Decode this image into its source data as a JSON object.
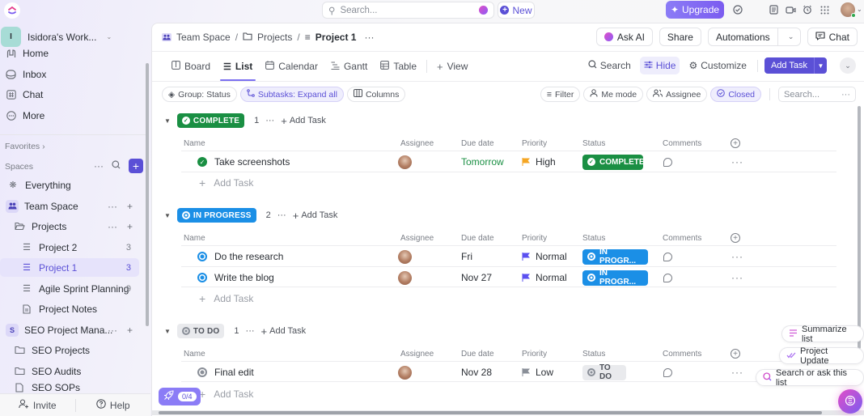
{
  "topbar": {
    "search_placeholder": "Search...",
    "new_label": "New",
    "upgrade_label": "Upgrade"
  },
  "sidebar": {
    "workspace_initial": "I",
    "workspace_name": "Isidora's Work...",
    "nav": [
      {
        "label": "Home",
        "icon": "home-icon"
      },
      {
        "label": "Inbox",
        "icon": "inbox-icon"
      },
      {
        "label": "Chat",
        "icon": "chat-icon"
      },
      {
        "label": "More",
        "icon": "more-icon"
      }
    ],
    "favorites_label": "Favorites",
    "spaces_label": "Spaces",
    "tree": [
      {
        "label": "Everything",
        "icon": "everything-icon"
      },
      {
        "label": "Team Space",
        "icon": "team-space-icon"
      },
      {
        "label": "Projects",
        "icon": "folder-open-icon"
      },
      {
        "label": "Project 2",
        "icon": "list-icon",
        "count": "3"
      },
      {
        "label": "Project 1",
        "icon": "list-icon",
        "count": "3",
        "active": true
      },
      {
        "label": "Agile Sprint Planning",
        "icon": "list-icon",
        "count": "9"
      },
      {
        "label": "Project Notes",
        "icon": "doc-icon"
      },
      {
        "label": "SEO Project Mana...",
        "icon": "space-s-icon",
        "initial": "S"
      },
      {
        "label": "SEO Projects",
        "icon": "folder-icon"
      },
      {
        "label": "SEO Audits",
        "icon": "folder-icon"
      },
      {
        "label": "SEO SOPs",
        "icon": "doc-icon"
      }
    ],
    "invite_label": "Invite",
    "help_label": "Help"
  },
  "header": {
    "breadcrumb": [
      "Team Space",
      "Projects",
      "Project 1"
    ],
    "ask_ai_label": "Ask AI",
    "share_label": "Share",
    "automations_label": "Automations",
    "chat_label": "Chat"
  },
  "views": {
    "tabs": [
      {
        "label": "Board",
        "icon": "board-icon"
      },
      {
        "label": "List",
        "icon": "list-icon",
        "active": true
      },
      {
        "label": "Calendar",
        "icon": "calendar-icon"
      },
      {
        "label": "Gantt",
        "icon": "gantt-icon"
      },
      {
        "label": "Table",
        "icon": "table-icon"
      }
    ],
    "add_view_label": "View",
    "search_label": "Search",
    "hide_label": "Hide",
    "customize_label": "Customize",
    "add_task_label": "Add Task"
  },
  "filters": {
    "group_label": "Group: Status",
    "subtasks_label": "Subtasks: Expand all",
    "columns_label": "Columns",
    "filter_label": "Filter",
    "me_mode_label": "Me mode",
    "assignee_label": "Assignee",
    "closed_label": "Closed",
    "search_placeholder": "Search..."
  },
  "columns": [
    "Name",
    "Assignee",
    "Due date",
    "Priority",
    "Status",
    "Comments"
  ],
  "groups": [
    {
      "status": "COMPLETE",
      "kind": "complete",
      "count": "1",
      "add_task_label": "Add Task",
      "tasks": [
        {
          "name": "Take screenshots",
          "due": "Tomorrow",
          "due_kind": "soon",
          "priority": "High",
          "priority_color": "#f5a623",
          "status": "COMPLETE"
        }
      ]
    },
    {
      "status": "IN PROGRESS",
      "kind": "inprog",
      "count": "2",
      "add_task_label": "Add Task",
      "tasks": [
        {
          "name": "Do the research",
          "due": "Fri",
          "priority": "Normal",
          "priority_color": "#5b50f0",
          "status": "IN PROGR..."
        },
        {
          "name": "Write the blog",
          "due": "Nov 27",
          "priority": "Normal",
          "priority_color": "#5b50f0",
          "status": "IN PROGR..."
        }
      ]
    },
    {
      "status": "TO DO",
      "kind": "todo",
      "count": "1",
      "add_task_label": "Add Task",
      "tasks": [
        {
          "name": "Final edit",
          "due": "Nov 28",
          "priority": "Low",
          "priority_color": "#8a8f98",
          "status": "TO DO"
        }
      ]
    }
  ],
  "add_task_row_label": "Add Task",
  "rocket_progress": "0/4",
  "ai_suggestions": [
    "Summarize list",
    "Project Update",
    "Search or ask this list"
  ],
  "colors": {
    "accent": "#5b50d6",
    "complete": "#1a8f43",
    "in_progress": "#1b8fe6",
    "todo": "#e9eaed"
  }
}
